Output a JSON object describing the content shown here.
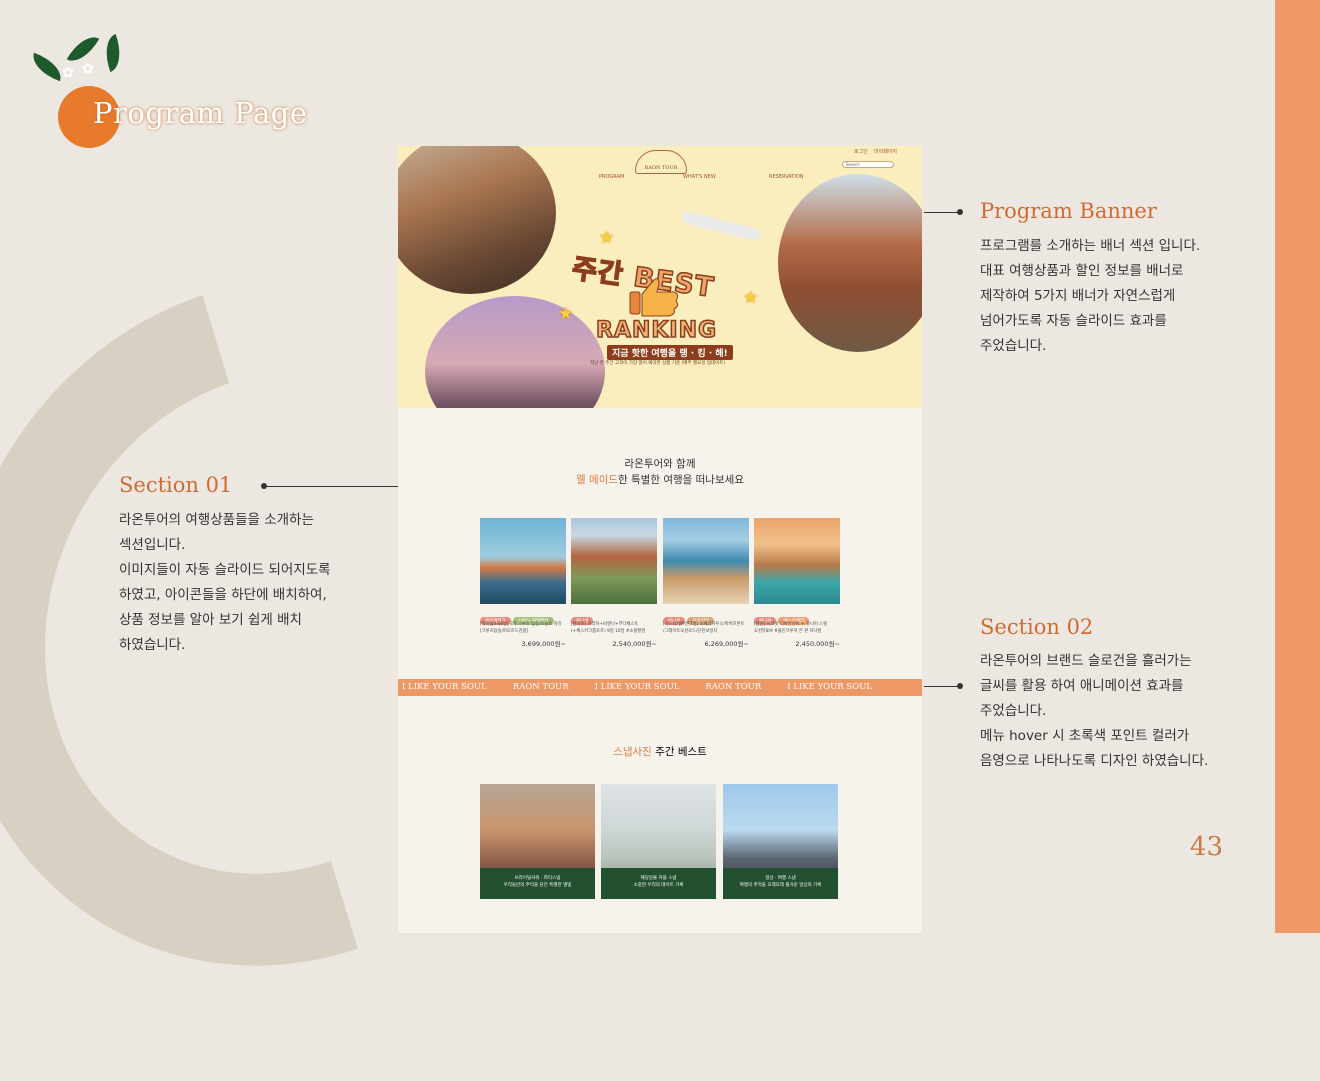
{
  "page": {
    "title": "Program Page",
    "page_number": "43",
    "accent_color": "#ee9866"
  },
  "annotations": [
    {
      "heading": "Program Banner",
      "lines": "프로그램를 소개하는 배너 섹션 입니다.\n대표 여행상품과 할인 정보를 배너로\n제작하여 5가지 배너가 자연스럽게\n넘어가도록 자동 슬라이드 효과를\n주었습니다."
    },
    {
      "heading": "Section 01",
      "lines": "라온투어의 여행상품들을 소개하는\n섹션입니다.\n이미지들이 자동 슬라이드 되어지도록\n하였고, 아이콘들을 하단에 배치하여,\n상품 정보를 알아 보기 쉽게 배치\n하였습니다."
    },
    {
      "heading": "Section 02",
      "lines": "라온투어의 브랜드 슬로건을 흘러가는\n글씨를 활용 하여 애니메이션 효과를\n주었습니다.\n메뉴 hover 시 초록색 포인트 컬러가\n음영으로 나타나도록 디자인 하였습니다."
    }
  ],
  "site": {
    "brand": "RAON TOUR",
    "util_links": [
      "로그인",
      "마이페이지"
    ],
    "search_placeholder": "Search",
    "nav": [
      "PROGRAM",
      "WHAT'S NEW",
      "RESERVATION"
    ],
    "banner": {
      "headline_top": "주간 BEST",
      "headline_bottom": "RANKING",
      "subline": "지금 핫한 여행을 랭 · 킹 · 해!",
      "caption": "지난 한 주간 고객이 가장 많이 예약한 상품 기준 (매주 월요일 업데이트)"
    },
    "section1": {
      "line1": "라온투어와 함께",
      "line2_accent": "웰 메이드",
      "line2_rest": "한 특별한 여행을 떠나보세요",
      "products": [
        {
          "tags": [
            "제휴혜택가",
            "100% 출발확정"
          ],
          "desc": "[북유럽4국8일] 3대 크루즈 탑승/오슬로 자유\n[크루즈탑승/피오르드관광]",
          "price": "3,699,000원~"
        },
        {
          "tags": [
            "위니셜"
          ],
          "desc": "[반자유] 프라하+비엔나+부다페스트\n(+체스키크룸로프) 9일 10일 #소셜할영",
          "price": "2,540,000원~"
        },
        {
          "tags": [
            "위니셜",
            "프리미엄"
          ],
          "desc": "[시드니/멜버른7일] 오페라하우스/마버프론트\n/그레이트오션로드/단진보빙지",
          "price": "6,269,000원~"
        },
        {
          "tags": [
            "위니셜",
            "베스트셀러"
          ],
          "desc": "[전관] 시크릿 디파인건비 + 쥬니어 스윗\n오션뷰8/9 #물인크루져 은 판 하나원",
          "price": "2,450,000원~"
        }
      ]
    },
    "marquee": [
      "I LIKE YOUR SOUL",
      "RAON TOUR",
      "I LIKE YOUR SOUL",
      "RAON TOUR",
      "I LIKE YOUR SOUL"
    ],
    "section2": {
      "title_accent": "스냅사진",
      "title_rest": "주간 베스트",
      "photos": [
        {
          "caption": "브라이덜샤워 · 파티스냅\n우리들만의 추억을 담은 특별한 별빛"
        },
        {
          "caption": "웨딩일몰 커플 스냅\n소중한 우리의 데이트 기록"
        },
        {
          "caption": "일상 · 여행 스냅\n여행의 추억을 모래모래 즐거운 일상의 기록"
        }
      ]
    }
  }
}
